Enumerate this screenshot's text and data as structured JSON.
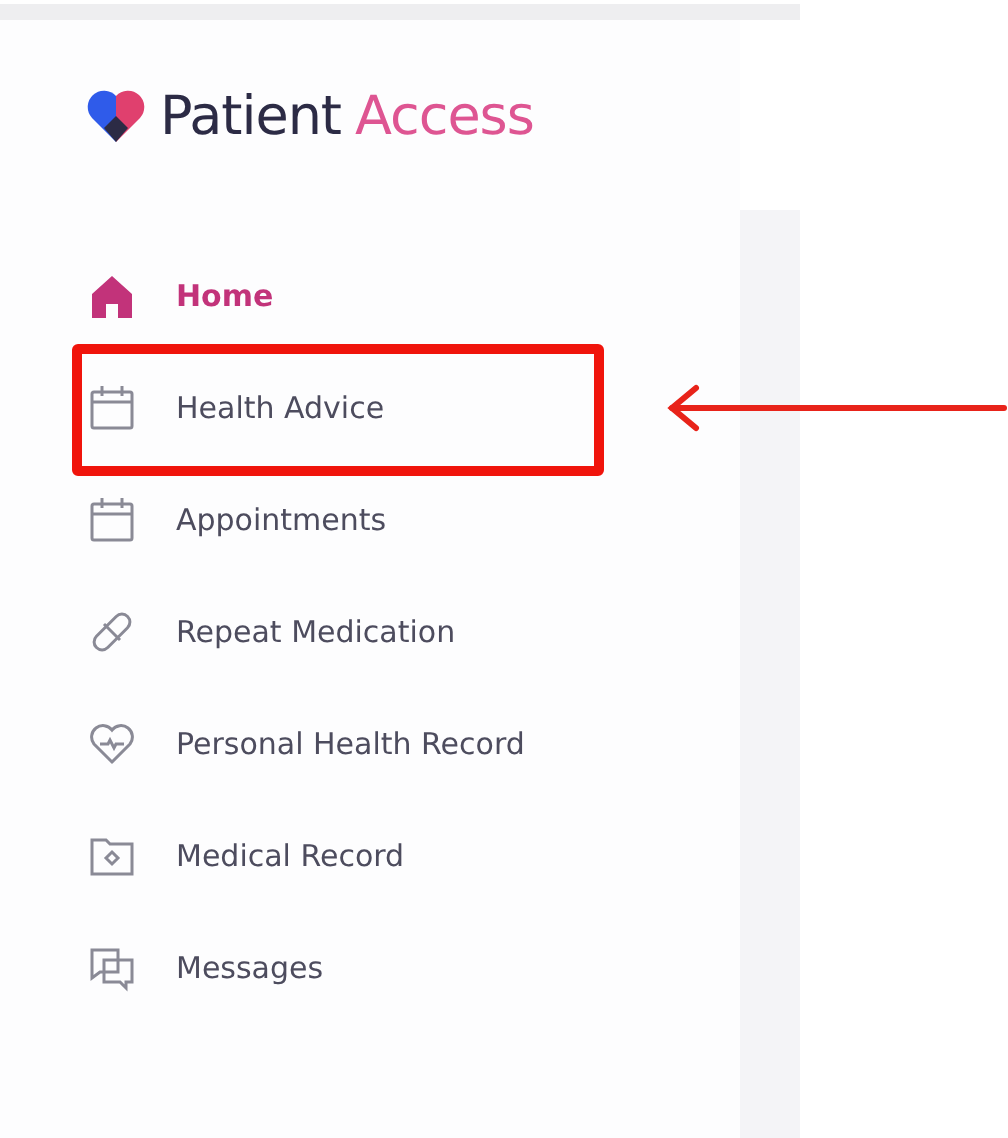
{
  "brand": {
    "name": "Patient",
    "accent": "Access"
  },
  "sidebar": {
    "items": [
      {
        "label": "Home",
        "kind": "home",
        "selected": true,
        "annotated": false
      },
      {
        "label": "Health Advice",
        "kind": "calendar",
        "selected": false,
        "annotated": true
      },
      {
        "label": "Appointments",
        "kind": "calendar",
        "selected": false,
        "annotated": false
      },
      {
        "label": "Repeat Medication",
        "kind": "pill",
        "selected": false,
        "annotated": false
      },
      {
        "label": "Personal Health Record",
        "kind": "heart",
        "selected": false,
        "annotated": false
      },
      {
        "label": "Medical Record",
        "kind": "folder",
        "selected": false,
        "annotated": false
      },
      {
        "label": "Messages",
        "kind": "chat",
        "selected": false,
        "annotated": false
      }
    ]
  }
}
